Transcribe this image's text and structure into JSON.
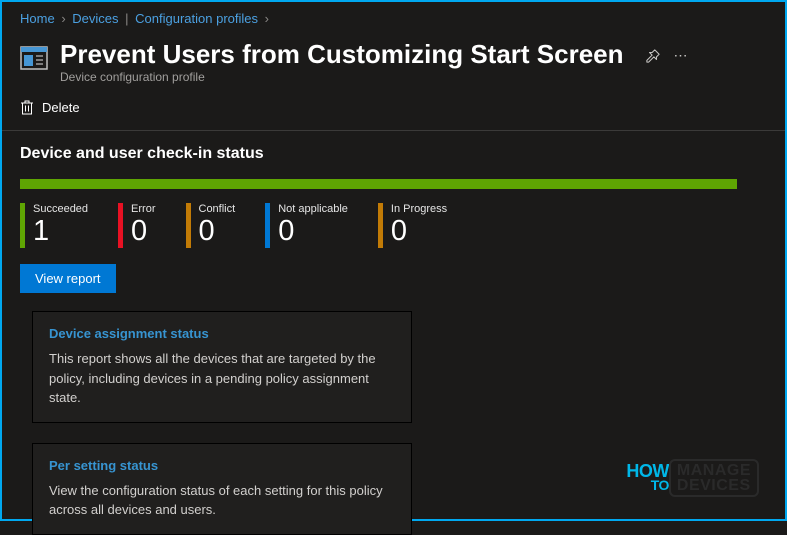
{
  "breadcrumb": {
    "home": "Home",
    "devices": "Devices",
    "config": "Configuration profiles"
  },
  "header": {
    "title": "Prevent Users from Customizing Start Screen",
    "subtitle": "Device configuration profile"
  },
  "toolbar": {
    "delete_label": "Delete"
  },
  "section": {
    "title": "Device and user check-in status"
  },
  "stats": [
    {
      "label": "Succeeded",
      "value": "1",
      "color": "#5fa503"
    },
    {
      "label": "Error",
      "value": "0",
      "color": "#e81123"
    },
    {
      "label": "Conflict",
      "value": "0",
      "color": "#c27b06"
    },
    {
      "label": "Not applicable",
      "value": "0",
      "color": "#0078d4"
    },
    {
      "label": "In Progress",
      "value": "0",
      "color": "#c27b06"
    }
  ],
  "buttons": {
    "view_report": "View report"
  },
  "cards": [
    {
      "title": "Device assignment status",
      "desc": "This report shows all the devices that are targeted by the policy, including devices in a pending policy assignment state."
    },
    {
      "title": "Per setting status",
      "desc": "View the configuration status of each setting for this policy across all devices and users."
    }
  ],
  "watermark": {
    "how": "HOW",
    "to": "TO",
    "line1": "MANAGE",
    "line2": "DEVICES"
  }
}
